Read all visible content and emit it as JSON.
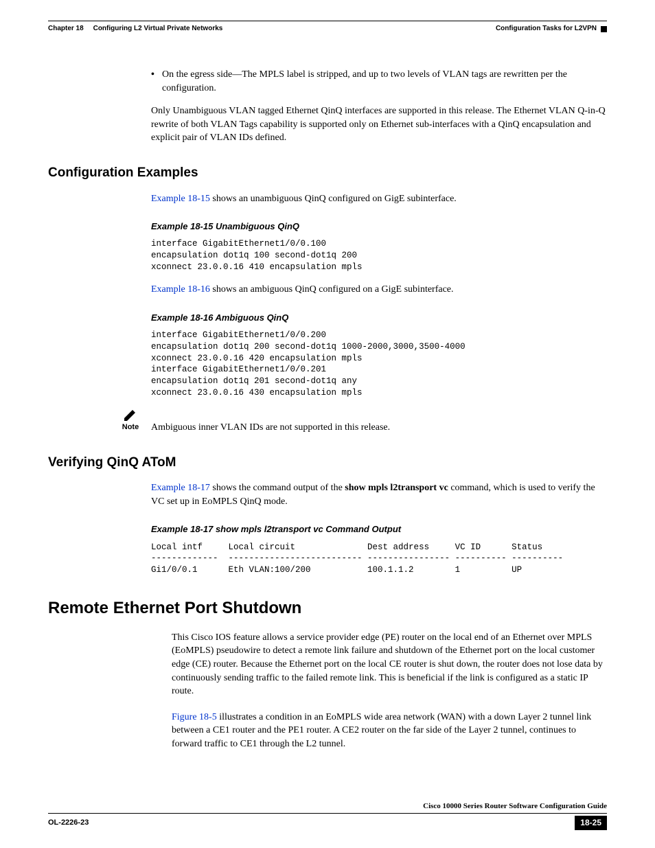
{
  "header": {
    "chapter_label": "Chapter 18",
    "chapter_title": "Configuring L2 Virtual Private Networks",
    "right_text": "Configuration Tasks for L2VPN"
  },
  "bullet": {
    "text": "On the egress side—The MPLS label is stripped, and up to two levels of VLAN tags are rewritten per the configuration."
  },
  "para1": "Only Unambiguous VLAN tagged Ethernet QinQ interfaces are supported in this release. The Ethernet VLAN Q-in-Q rewrite of both VLAN Tags capability is supported only on Ethernet sub-interfaces with a QinQ encapsulation and explicit pair of VLAN IDs defined.",
  "section_config_examples": "Configuration Examples",
  "para2_link": "Example 18-15",
  "para2_rest": " shows an unambiguous QinQ configured on GigE subinterface.",
  "example15_title": "Example 18-15 Unambiguous QinQ",
  "example15_code": "interface GigabitEthernet1/0/0.100\nencapsulation dot1q 100 second-dot1q 200\nxconnect 23.0.0.16 410 encapsulation mpls",
  "para3_link": "Example 18-16",
  "para3_rest": " shows an ambiguous QinQ configured on a GigE subinterface.",
  "example16_title": "Example 18-16 Ambiguous QinQ",
  "example16_code": "interface GigabitEthernet1/0/0.200\nencapsulation dot1q 200 second-dot1q 1000-2000,3000,3500-4000\nxconnect 23.0.0.16 420 encapsulation mpls\ninterface GigabitEthernet1/0/0.201\nencapsulation dot1q 201 second-dot1q any\nxconnect 23.0.0.16 430 encapsulation mpls",
  "note_label": "Note",
  "note_text": "Ambiguous inner VLAN IDs are not supported in this release.",
  "section_verify": "Verifying QinQ AToM",
  "para4_link": "Example 18-17",
  "para4_rest_a": " shows the command output of the ",
  "para4_bold": "show mpls l2transport vc",
  "para4_rest_b": " command, which is used to verify the VC set up in EoMPLS QinQ mode.",
  "example17_title": "Example 18-17 show mpls l2transport vc Command Output",
  "example17_code": "Local intf     Local circuit              Dest address     VC ID      Status\n-------------  -------------------------- ---------------- ---------- ----------\nGi1/0/0.1      Eth VLAN:100/200           100.1.1.2        1          UP",
  "section_remote": "Remote Ethernet Port Shutdown",
  "para5": "This Cisco IOS feature allows a service provider edge (PE) router on the local end of an Ethernet over MPLS (EoMPLS) pseudowire to detect a remote link failure and shutdown of the Ethernet port on the local customer edge (CE) router. Because the Ethernet port on the local CE router is shut down, the router does not lose data by continuously sending traffic to the failed remote link. This is beneficial if the link is configured as a static IP route.",
  "para6_link": "Figure 18-5",
  "para6_rest": " illustrates a condition in an EoMPLS wide area network (WAN) with a down Layer 2 tunnel link between a CE1 router and the PE1 router. A CE2 router on the far side of the Layer 2 tunnel, continues to forward traffic to CE1 through the L2 tunnel.",
  "footer": {
    "guide": "Cisco 10000 Series Router Software Configuration Guide",
    "ol": "OL-2226-23",
    "page": "18-25"
  }
}
